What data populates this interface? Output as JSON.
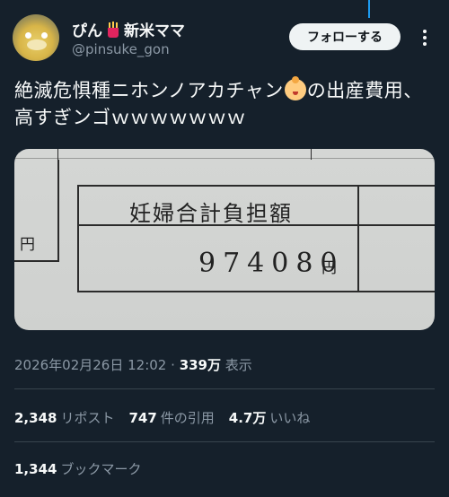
{
  "author": {
    "name_prefix": "ぴん",
    "name_suffix": "新米ママ",
    "handle": "@pinsuke_gon"
  },
  "follow_label": "フォローする",
  "tweet": {
    "text_before": "絶滅危惧種ニホンノアカチャン",
    "text_after": "の出産費用、高すぎンゴｗｗｗｗｗｗｗ"
  },
  "photo": {
    "label": "妊婦合計負担額",
    "amount": "974080",
    "currency": "円",
    "currency_left": "円"
  },
  "meta": {
    "timestamp": "2026年02月26日 12:02",
    "separator": "·",
    "views_count": "339万",
    "views_label": "表示"
  },
  "stats": {
    "reposts_count": "2,348",
    "reposts_label": "リポスト",
    "quotes_count": "747",
    "quotes_label": "件の引用",
    "likes_count": "4.7万",
    "likes_label": "いいね",
    "bookmarks_count": "1,344",
    "bookmarks_label": "ブックマーク"
  },
  "colors": {
    "background": "#15202b",
    "text": "#f7f9f9",
    "muted": "#8b98a5",
    "accent": "#1d9bf0"
  },
  "icons": [
    "fries-icon",
    "baby-icon",
    "more-icon"
  ]
}
